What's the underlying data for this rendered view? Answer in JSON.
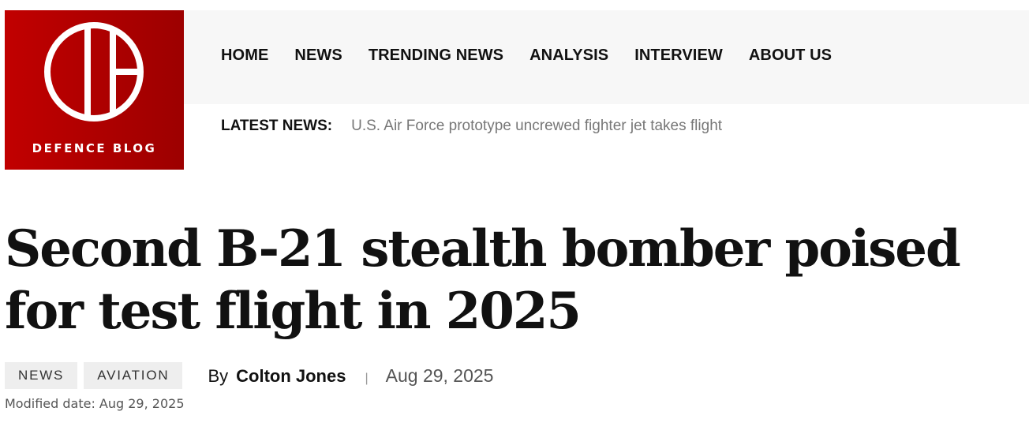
{
  "brand": {
    "name": "DEFENCE BLOG",
    "color": "#b30000"
  },
  "nav": {
    "items": [
      "HOME",
      "NEWS",
      "TRENDING NEWS",
      "ANALYSIS",
      "INTERVIEW",
      "ABOUT US"
    ]
  },
  "ticker": {
    "label": "LATEST NEWS:",
    "headline": "U.S. Air Force prototype uncrewed fighter jet takes flight"
  },
  "article": {
    "title": "Second B-21 stealth bomber poised for test flight in 2025",
    "tags": [
      "NEWS",
      "AVIATION"
    ],
    "by_prefix": "By",
    "author": "Colton Jones",
    "separator": "|",
    "date": "Aug 29, 2025",
    "modified": "Modified date: Aug 29, 2025"
  }
}
